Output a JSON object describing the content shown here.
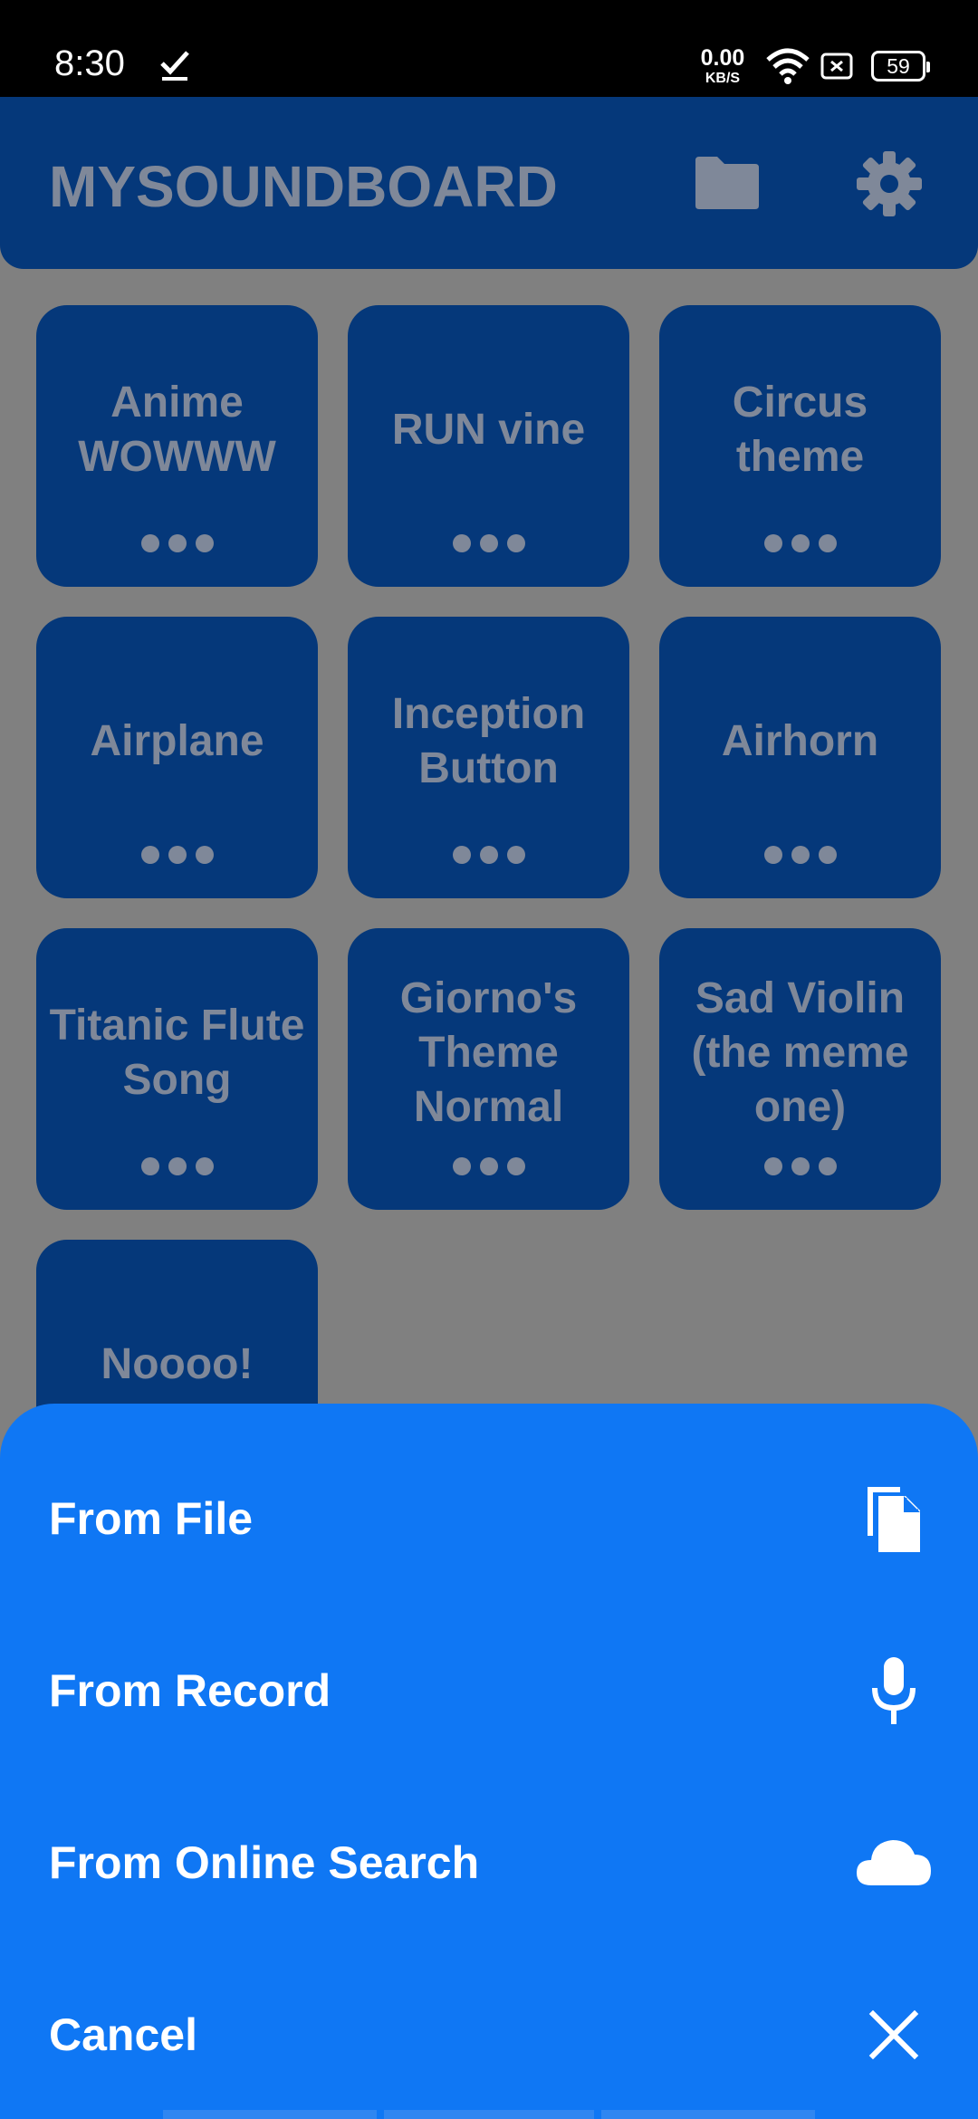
{
  "status_bar": {
    "time": "8:30",
    "net_speed_value": "0.00",
    "net_speed_unit": "KB/S",
    "battery": "59",
    "icons": [
      "download-done-icon",
      "wifi-icon",
      "sim-icon",
      "battery-icon"
    ]
  },
  "app_bar": {
    "title": "MYSOUNDBOARD",
    "icons": [
      "folder-icon",
      "gear-icon"
    ],
    "color": "#05387a"
  },
  "sounds": [
    {
      "label": "Anime WOWWW"
    },
    {
      "label": "RUN vine"
    },
    {
      "label": "Circus theme"
    },
    {
      "label": "Airplane"
    },
    {
      "label": "Inception Button"
    },
    {
      "label": "Airhorn"
    },
    {
      "label": "Titanic Flute Song"
    },
    {
      "label": "Giorno's Theme Normal"
    },
    {
      "label": "Sad Violin (the meme one)"
    },
    {
      "label": "Noooo!"
    }
  ],
  "sheet": {
    "color": "#0f77f4",
    "items": [
      {
        "label": "From File",
        "icon": "file-copy-icon"
      },
      {
        "label": "From Record",
        "icon": "microphone-icon"
      },
      {
        "label": "From Online Search",
        "icon": "cloud-icon"
      },
      {
        "label": "Cancel",
        "icon": "close-icon"
      }
    ]
  }
}
